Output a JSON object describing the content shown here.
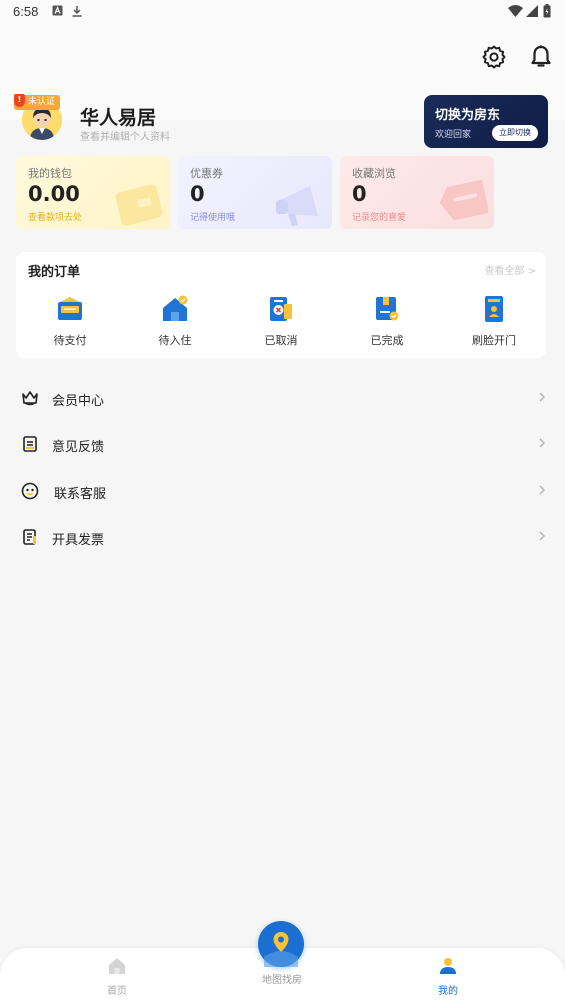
{
  "status_bar": {
    "time": "6:58"
  },
  "profile": {
    "name": "华人易居",
    "subtitle": "查看并编辑个人资料",
    "badge": "未认证"
  },
  "switch_card": {
    "title": "切换为房东",
    "subtitle": "欢迎回家",
    "button": "立即切换"
  },
  "stats": [
    {
      "title": "我的钱包",
      "value": "0.00",
      "note": "查看款项去处",
      "note_color": "#e5b313"
    },
    {
      "title": "优惠券",
      "value": "0",
      "note": "记得使用哦",
      "note_color": "#8a8fe6"
    },
    {
      "title": "收藏浏览",
      "value": "0",
      "note": "记录您的喜爱",
      "note_color": "#f08a8a"
    }
  ],
  "orders": {
    "title": "我的订单",
    "view_all": "查看全部 >",
    "items": [
      {
        "label": "待支付",
        "icon": "wallet-icon"
      },
      {
        "label": "待入住",
        "icon": "house-icon"
      },
      {
        "label": "已取消",
        "icon": "cancelled-icon"
      },
      {
        "label": "已完成",
        "icon": "completed-icon"
      },
      {
        "label": "刷脸开门",
        "icon": "face-door-icon"
      }
    ]
  },
  "menu": [
    {
      "label": "会员中心",
      "icon": "crown-icon"
    },
    {
      "label": "意见反馈",
      "icon": "feedback-icon"
    },
    {
      "label": "联系客服",
      "icon": "smiley-icon"
    },
    {
      "label": "开具发票",
      "icon": "invoice-icon"
    }
  ],
  "bottom_nav": {
    "home": "首页",
    "map": "地图找房",
    "mine": "我的"
  },
  "colors": {
    "accent": "#1a6fd0",
    "wallet_bg": "#fff8d8",
    "coupon_bg": "#eeeefe",
    "fav_bg": "#fde6e6"
  }
}
